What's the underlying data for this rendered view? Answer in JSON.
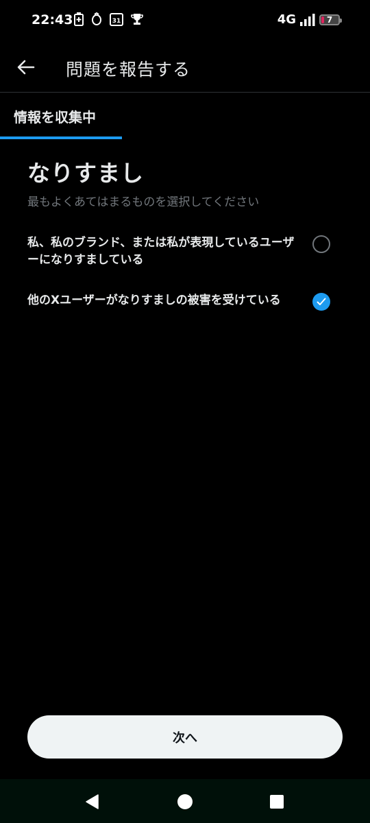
{
  "status_bar": {
    "time": "22:43",
    "network": "4G",
    "battery_level": "7"
  },
  "header": {
    "title": "問題を報告する"
  },
  "progress": {
    "step_label": "情報を収集中",
    "fraction": 0.33
  },
  "content": {
    "heading": "なりすまし",
    "subheading": "最もよくあてはまるものを選択してください",
    "options": [
      {
        "label": "私、私のブランド、または私が表現しているユーザーになりすましている",
        "selected": false
      },
      {
        "label": "他のXユーザーがなりすましの被害を受けている",
        "selected": true
      }
    ]
  },
  "footer": {
    "next_label": "次へ"
  },
  "colors": {
    "accent": "#1d9bf0",
    "background": "#000000",
    "text": "#e7e9ea",
    "muted": "#71767b"
  }
}
